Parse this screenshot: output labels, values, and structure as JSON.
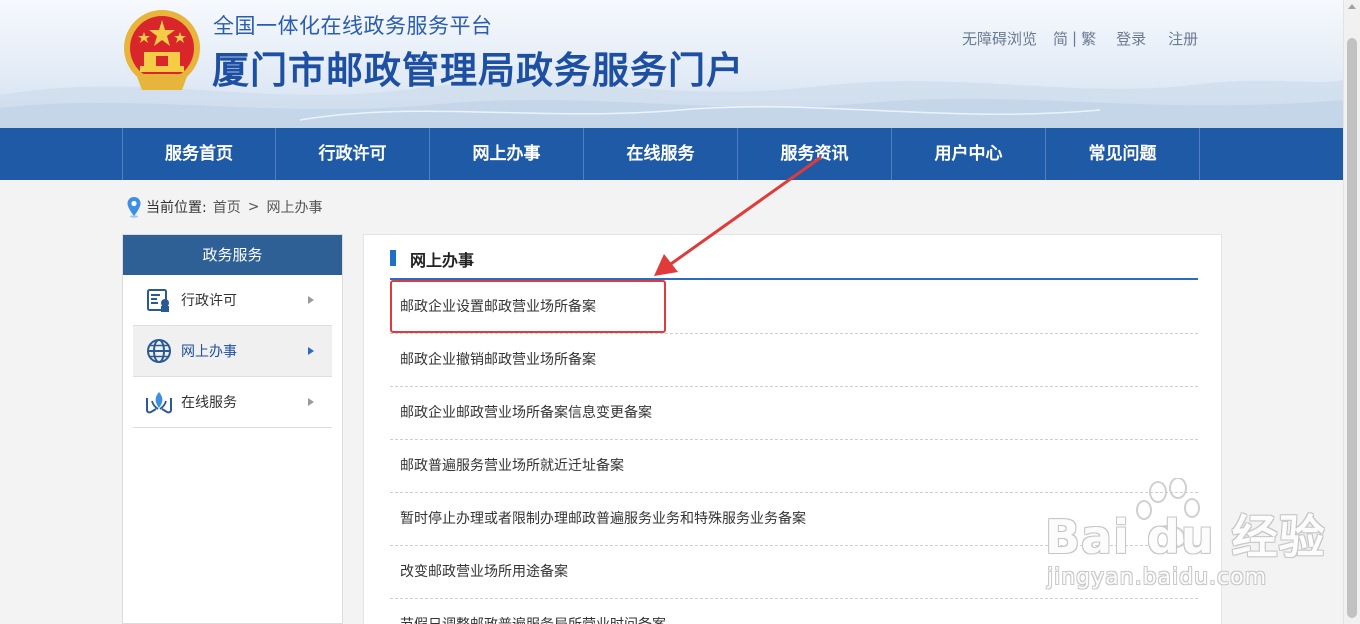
{
  "header": {
    "subtitle": "全国一体化在线政务服务平台",
    "title": "厦门市邮政管理局政务服务门户",
    "links": {
      "accessible": "无障碍浏览",
      "simplified": "简",
      "divider": "|",
      "traditional": "繁",
      "login": "登录",
      "register": "注册"
    }
  },
  "nav": {
    "items": [
      "服务首页",
      "行政许可",
      "网上办事",
      "在线服务",
      "服务资讯",
      "用户中心",
      "常见问题"
    ]
  },
  "breadcrumb": {
    "label": "当前位置:",
    "home": "首页",
    "separator": ">",
    "current": "网上办事"
  },
  "sidebar": {
    "title": "政务服务",
    "items": [
      {
        "label": "行政许可",
        "icon": "license-document-icon",
        "active": false
      },
      {
        "label": "网上办事",
        "icon": "globe-icon",
        "active": true
      },
      {
        "label": "在线服务",
        "icon": "hands-service-icon",
        "active": false
      }
    ]
  },
  "main": {
    "title": "网上办事",
    "items": [
      "邮政企业设置邮政营业场所备案",
      "邮政企业撤销邮政营业场所备案",
      "邮政企业邮政营业场所备案信息变更备案",
      "邮政普遍服务营业场所就近迁址备案",
      "暂时停止办理或者限制办理邮政普遍服务业务和特殊服务业务备案",
      "改变邮政营业场所用途备案",
      "节假日调整邮政普遍服务局所营业时间备案"
    ]
  },
  "watermark": {
    "brand": "Bai du 经验",
    "url": "jingyan.baidu.com"
  },
  "colors": {
    "nav": "#1f5aa6",
    "sidebar_head": "#2e5f95",
    "accent": "#2c6bc2",
    "annotation": "#e03a3a"
  }
}
